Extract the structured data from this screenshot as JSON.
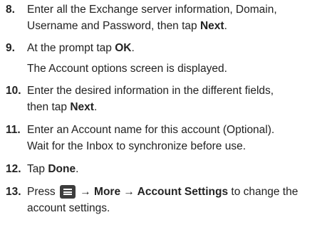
{
  "steps": [
    {
      "number": "8.",
      "line1_text": "Enter all the Exchange server information, Domain,",
      "line2_text": "Username and Password, then tap ",
      "line2_bold": "Next",
      "line2_end": "."
    },
    {
      "number": "9.",
      "line1_text": "At the prompt tap ",
      "line1_bold": "OK",
      "line1_end": ".",
      "line2_text": "The Account options screen is displayed."
    },
    {
      "number": "10.",
      "line1_text": "Enter the desired information in the different fields,",
      "line2_text": "then tap ",
      "line2_bold": "Next",
      "line2_end": "."
    },
    {
      "number": "11.",
      "line1_text": "Enter an Account name for this account (Optional).",
      "line2_text": "Wait for the Inbox to synchronize before use."
    },
    {
      "number": "12.",
      "line1_text": "Tap ",
      "line1_bold": "Done",
      "line1_end": "."
    },
    {
      "number": "13.",
      "line1_text": "Press ",
      "menu_icon": "menu-key-icon",
      "line1_bold": "→ More → Account Settings",
      "line1_end": " to change the",
      "line2_text": "account settings."
    }
  ]
}
